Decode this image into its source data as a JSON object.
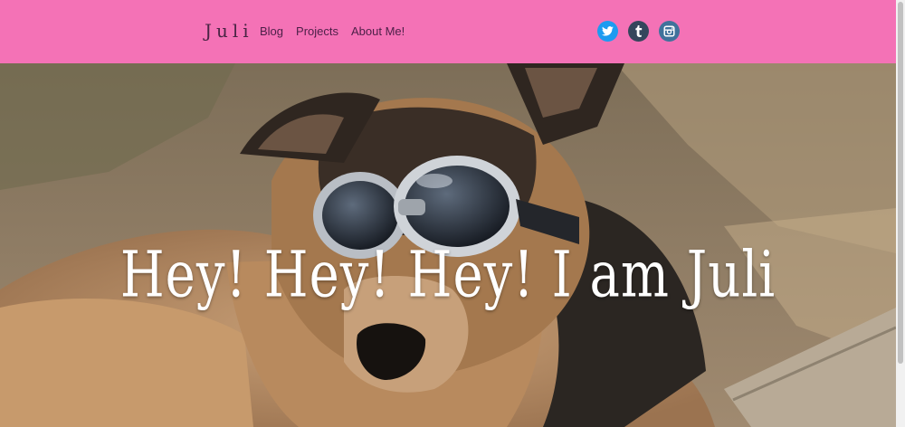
{
  "header": {
    "brand": "Juli",
    "nav": [
      {
        "label": "Blog"
      },
      {
        "label": "Projects"
      },
      {
        "label": "About Me!"
      }
    ],
    "socials": [
      {
        "icon": "twitter-icon",
        "color": "#1d9bf0"
      },
      {
        "icon": "tumblr-icon",
        "color": "#35465c"
      },
      {
        "icon": "instagram-icon",
        "color": "#3f729b"
      }
    ],
    "background_color": "#f472b6"
  },
  "hero": {
    "title": "Hey! Hey! Hey! I am Juli"
  }
}
